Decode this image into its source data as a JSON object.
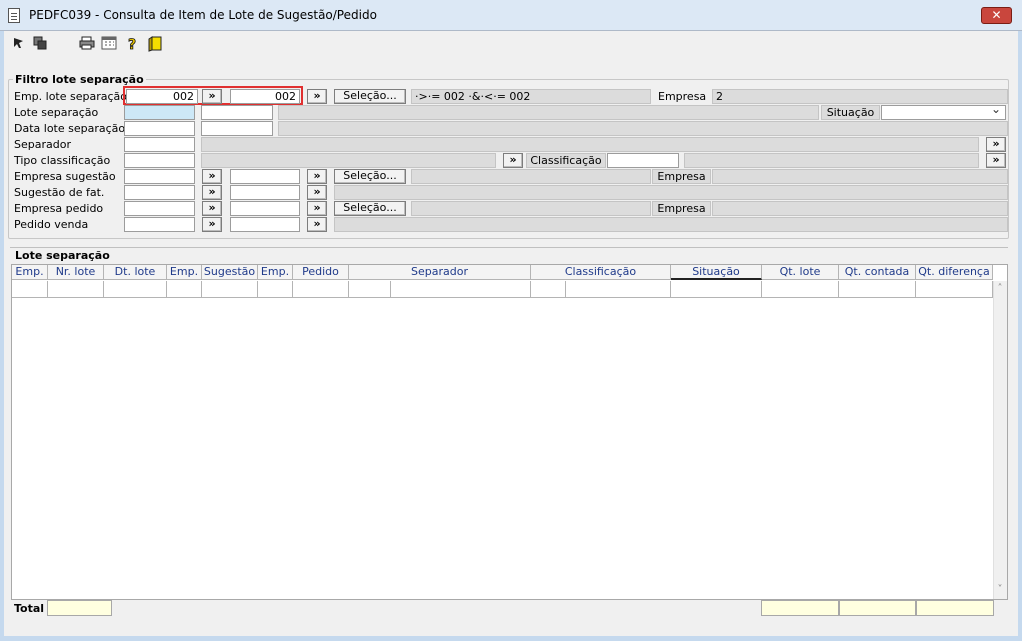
{
  "window": {
    "title": "PEDFC039 - Consulta de Item de Lote de Sugestão/Pedido",
    "close_label": "✕"
  },
  "toolbar": {
    "icons": [
      "arrow-select-icon",
      "copy-icon",
      "print-icon",
      "calendar-icon",
      "help-icon",
      "exit-icon"
    ]
  },
  "filter": {
    "legend": "Filtro lote separação",
    "emp_lote_label": "Emp. lote separação",
    "emp_lote_from": "002",
    "emp_lote_to": "002",
    "selecao_label": "Seleção...",
    "selection_expr": "·>·= 002 ·&·<·= 002",
    "empresa_label": "Empresa",
    "empresa_value": "2",
    "lote_label": "Lote separação",
    "situacao_label": "Situação",
    "situacao_value": "",
    "data_lote_label": "Data lote separação",
    "separador_label": "Separador",
    "tipo_class_label": "Tipo classificação",
    "classificacao_label": "Classificação",
    "empresa_sugestao_label": "Empresa sugestão",
    "sugestao_fat_label": "Sugestão de fat.",
    "empresa_pedido_label": "Empresa pedido",
    "pedido_venda_label": "Pedido venda",
    "arrow_label": "»"
  },
  "grid": {
    "legend": "Lote separação",
    "columns": [
      "Emp.",
      "Nr. lote",
      "Dt. lote",
      "Emp.",
      "Sugestão",
      "Emp.",
      "Pedido",
      "Separador",
      "Classificação",
      "Situação",
      "Qt. lote",
      "Qt. contada",
      "Qt. diferença"
    ],
    "scroll_up": "˄",
    "scroll_down": "˅"
  },
  "footer": {
    "total_label": "Total"
  }
}
